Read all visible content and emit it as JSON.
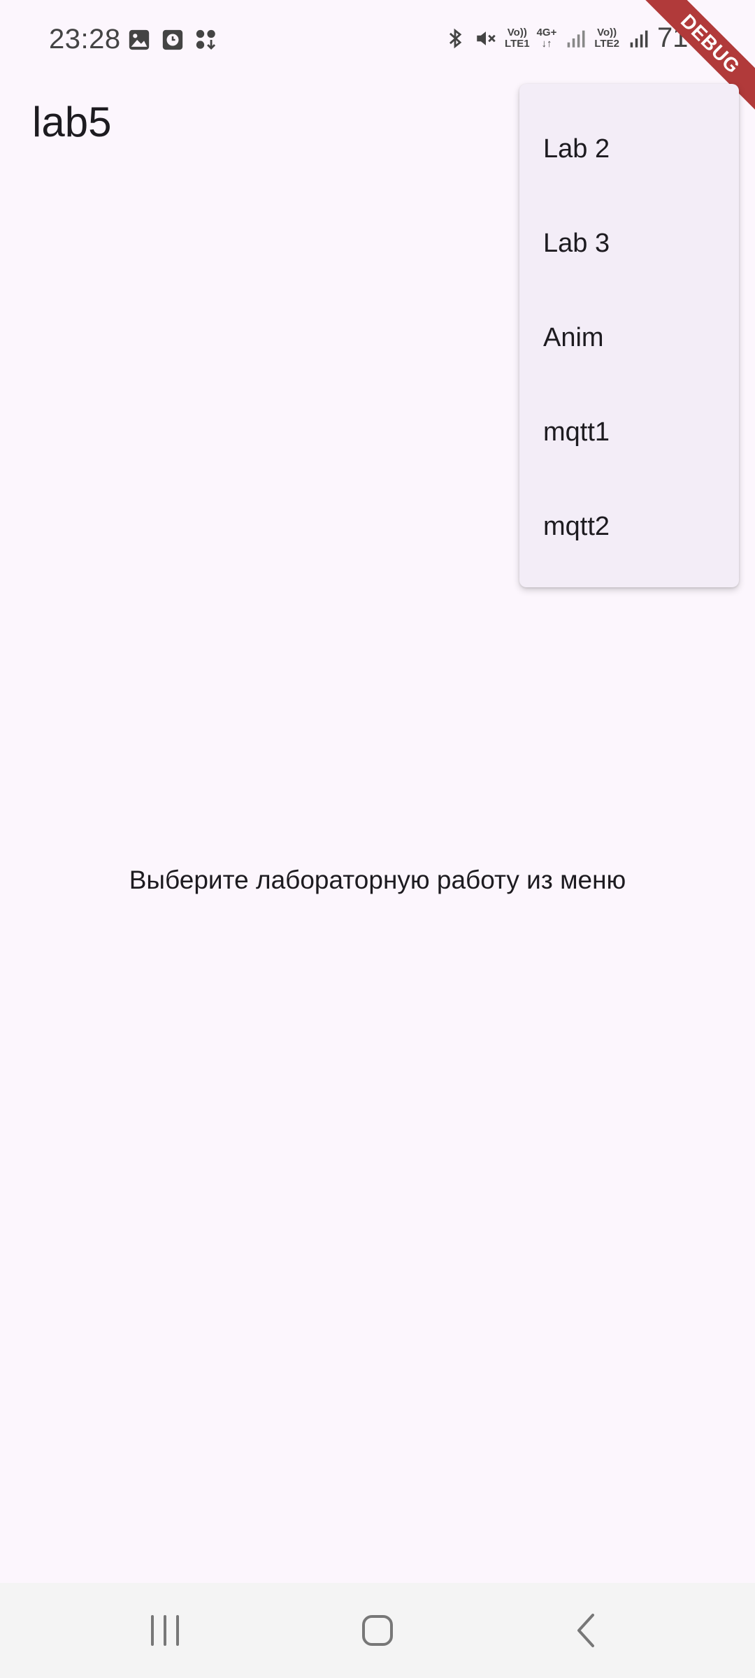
{
  "status_bar": {
    "time": "23:28",
    "net1_top": "Vo))",
    "net1_bottom": "LTE1",
    "net2_top": "4G+",
    "net3_top": "Vo))",
    "net3_bottom": "LTE2",
    "battery": "71%"
  },
  "debug_banner": "DEBUG",
  "app_bar": {
    "title": "lab5"
  },
  "menu": {
    "items": [
      {
        "label": "Lab 2"
      },
      {
        "label": "Lab 3"
      },
      {
        "label": "Anim"
      },
      {
        "label": "mqtt1"
      },
      {
        "label": "mqtt2"
      }
    ]
  },
  "main": {
    "message": "Выберите лабораторную работу из меню"
  },
  "colors": {
    "background": "#fcf6fd",
    "menu_background": "#f3edf7",
    "debug_ribbon": "#b13a3a",
    "nav_bar": "#f4f4f4"
  },
  "icons": {
    "status_left": [
      "image-icon",
      "clock-icon",
      "app-download-icon"
    ],
    "status_right": [
      "bluetooth-icon",
      "mute-icon",
      "signal-icon",
      "battery-icon"
    ],
    "nav": [
      "recent-apps-icon",
      "home-icon",
      "back-icon"
    ]
  }
}
